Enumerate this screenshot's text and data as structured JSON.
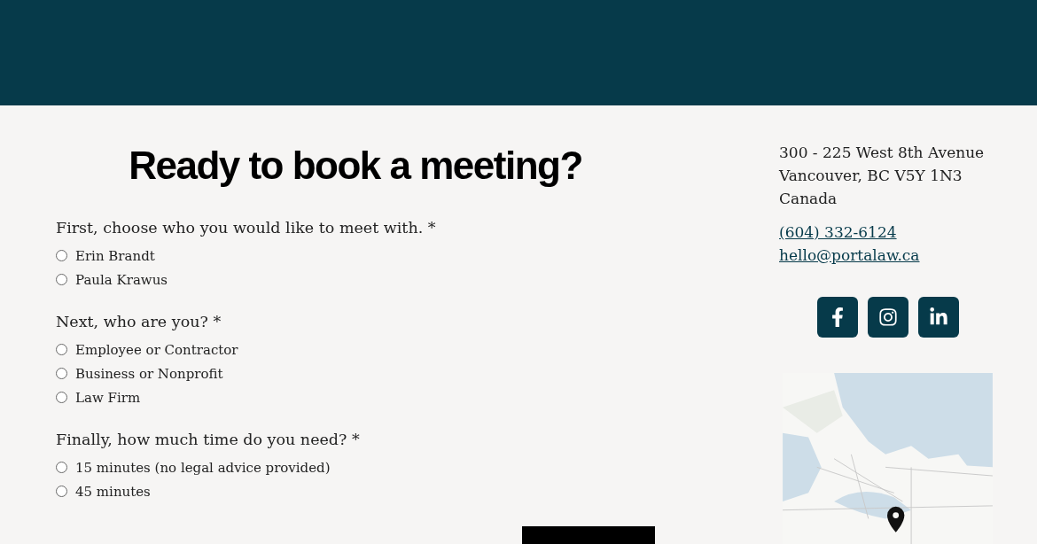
{
  "heading": "Ready to book a meeting?",
  "questions": [
    {
      "label": "First, choose who you would like to meet with. *",
      "options": [
        {
          "label": "Erin Brandt",
          "selected": false
        },
        {
          "label": "Paula Krawus",
          "selected": false
        }
      ]
    },
    {
      "label": "Next, who are you? *",
      "options": [
        {
          "label": "Employee or Contractor",
          "selected": false
        },
        {
          "label": "Business or Nonprofit",
          "selected": false
        },
        {
          "label": "Law Firm",
          "selected": false
        }
      ]
    },
    {
      "label": "Finally, how much time do you need? *",
      "options": [
        {
          "label": "15 minutes (no legal advice provided)",
          "selected": false
        },
        {
          "label": "45 minutes",
          "selected": false
        }
      ]
    }
  ],
  "address": [
    "300 - 225 West 8th Avenue",
    "Vancouver, BC V5Y 1N3",
    "Canada"
  ],
  "links": [
    "(604) 332-6124",
    "hello@portalaw.ca"
  ],
  "social": [
    {
      "kind": "facebook"
    },
    {
      "kind": "instagram"
    },
    {
      "kind": "linkedin"
    }
  ],
  "map": {
    "kind": "picture"
  }
}
